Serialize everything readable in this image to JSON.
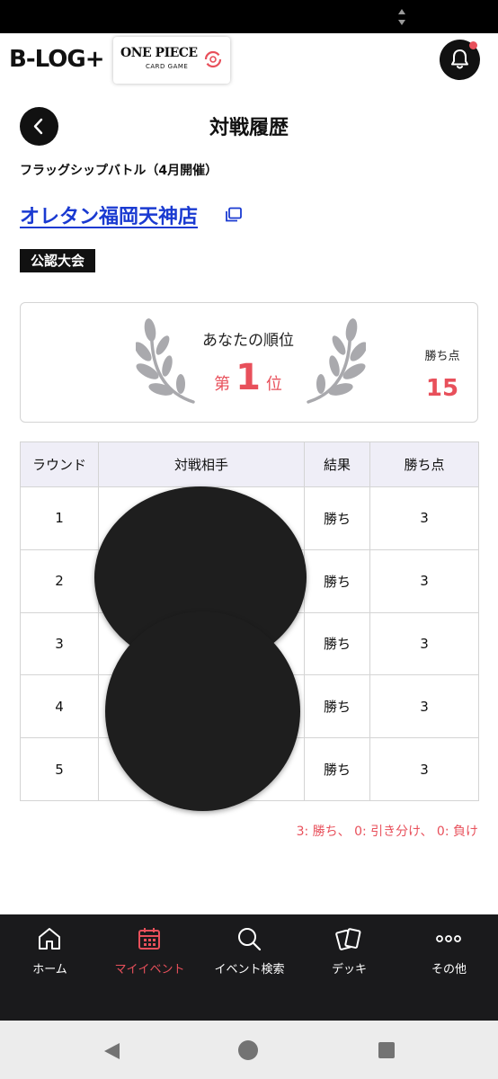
{
  "header": {
    "brand_logo": "B-LOG+",
    "card_game_logo_title": "ONE PIECE",
    "card_game_logo_subtitle": "CARD GAME"
  },
  "page": {
    "title": "対戦履歴",
    "event_name": "フラッグシップバトル（4月開催）",
    "store_name": "オレタン福岡天神店",
    "event_type_badge": "公認大会"
  },
  "ranking": {
    "label": "あなたの順位",
    "prefix": "第",
    "rank": "1",
    "suffix": "位",
    "points_label": "勝ち点",
    "points": "15"
  },
  "table": {
    "headers": [
      "ラウンド",
      "対戦相手",
      "結果",
      "勝ち点"
    ],
    "rows": [
      {
        "round": "1",
        "opponent": "",
        "result": "勝ち",
        "points": "3"
      },
      {
        "round": "2",
        "opponent": "",
        "result": "勝ち",
        "points": "3"
      },
      {
        "round": "3",
        "opponent": "",
        "result": "勝ち",
        "points": "3"
      },
      {
        "round": "4",
        "opponent": "",
        "result": "勝ち",
        "points": "3"
      },
      {
        "round": "5",
        "opponent": "",
        "result": "勝ち",
        "points": "3"
      }
    ]
  },
  "legend_note": "3: 勝ち、 0: 引き分け、 0: 負け",
  "bottom_nav": {
    "items": [
      {
        "label": "ホーム",
        "icon": "home-icon",
        "active": false
      },
      {
        "label": "マイイベント",
        "icon": "calendar-icon",
        "active": true
      },
      {
        "label": "イベント検索",
        "icon": "search-icon",
        "active": false
      },
      {
        "label": "デッキ",
        "icon": "cards-icon",
        "active": false
      },
      {
        "label": "その他",
        "icon": "more-icon",
        "active": false
      }
    ]
  },
  "colors": {
    "accent": "#e8505b",
    "link": "#1a3ad1",
    "table_header_bg": "#efeef7",
    "nav_bg": "#1a1a1c"
  }
}
